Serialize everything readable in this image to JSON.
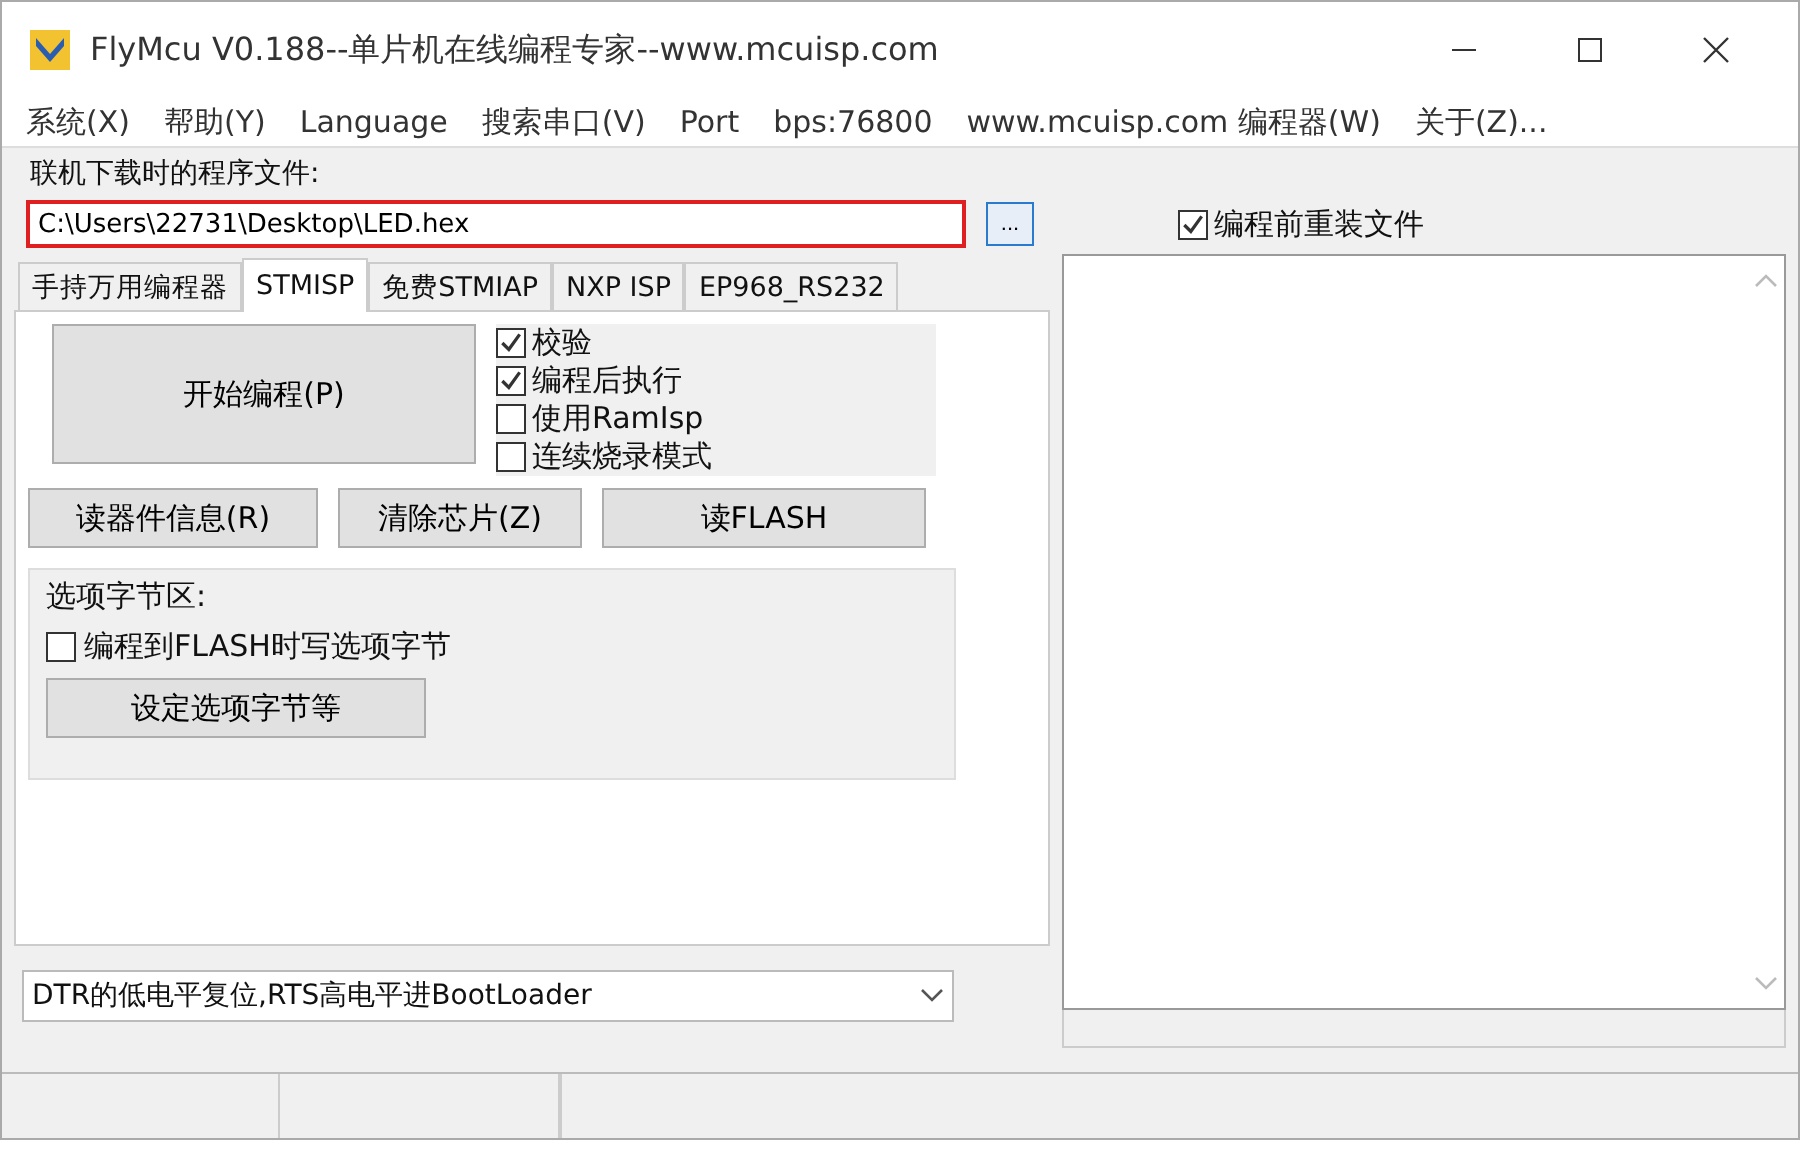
{
  "window": {
    "title": "FlyMcu V0.188--单片机在线编程专家--www.mcuisp.com"
  },
  "menu": [
    "系统(X)",
    "帮助(Y)",
    "Language",
    "搜索串口(V)",
    "Port",
    "bps:76800",
    "www.mcuisp.com 编程器(W)",
    "关于(Z)..."
  ],
  "file": {
    "label": "联机下载时的程序文件:",
    "value": "C:\\Users\\22731\\Desktop\\LED.hex",
    "browse": "..."
  },
  "reload": {
    "label": "编程前重装文件",
    "checked": true
  },
  "tabs": [
    {
      "label": "手持万用编程器",
      "selected": false
    },
    {
      "label": "STMISP",
      "selected": true
    },
    {
      "label": "免费STMIAP",
      "selected": false
    },
    {
      "label": "NXP ISP",
      "selected": false
    },
    {
      "label": "EP968_RS232",
      "selected": false
    }
  ],
  "start_button": "开始编程(P)",
  "options": [
    {
      "label": "校验",
      "checked": true
    },
    {
      "label": "编程后执行",
      "checked": true
    },
    {
      "label": "使用RamIsp",
      "checked": false
    },
    {
      "label": "连续烧录模式",
      "checked": false
    }
  ],
  "buttons": [
    "读器件信息(R)",
    "清除芯片(Z)",
    "读FLASH"
  ],
  "option_bytes": {
    "title": "选项字节区:",
    "checkbox": {
      "label": "编程到FLASH时写选项字节",
      "checked": false
    },
    "button": "设定选项字节等"
  },
  "reset_mode": {
    "value": "DTR的低电平复位,RTS高电平进BootLoader"
  }
}
